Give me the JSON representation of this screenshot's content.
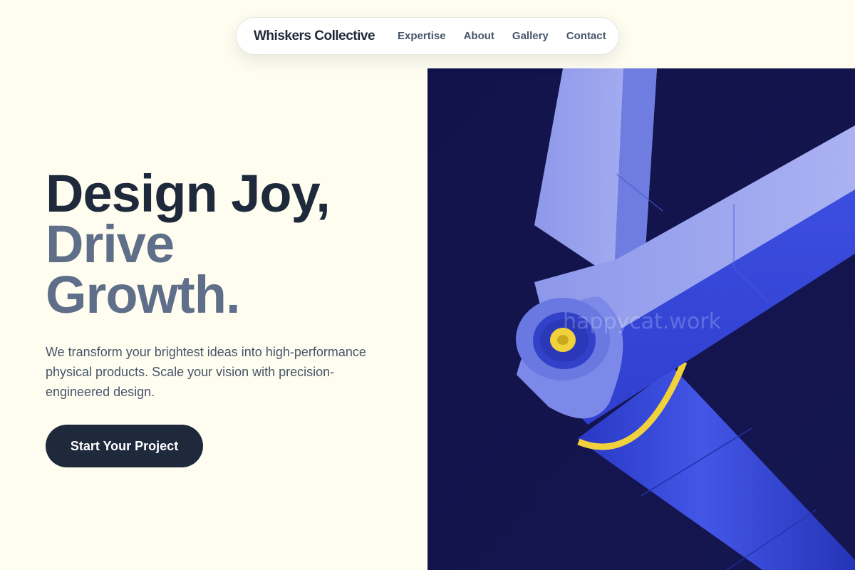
{
  "nav": {
    "brand": "Whiskers Collective",
    "links": [
      "Expertise",
      "About",
      "Gallery",
      "Contact"
    ]
  },
  "hero": {
    "headline_line1": "Design Joy,",
    "headline_line2": "Drive",
    "headline_line3": "Growth.",
    "description": "We transform your brightest ideas into high-performance physical products. Scale your vision with precision-engineered design.",
    "cta_label": "Start Your Project"
  },
  "image": {
    "watermark": "happycat.work"
  },
  "colors": {
    "background": "#fefdf0",
    "text_dark": "#1e293b",
    "text_muted": "#5f6f89",
    "image_bg": "#141546",
    "accent_blue": "#3a4fd9",
    "accent_yellow": "#f2d23a"
  }
}
